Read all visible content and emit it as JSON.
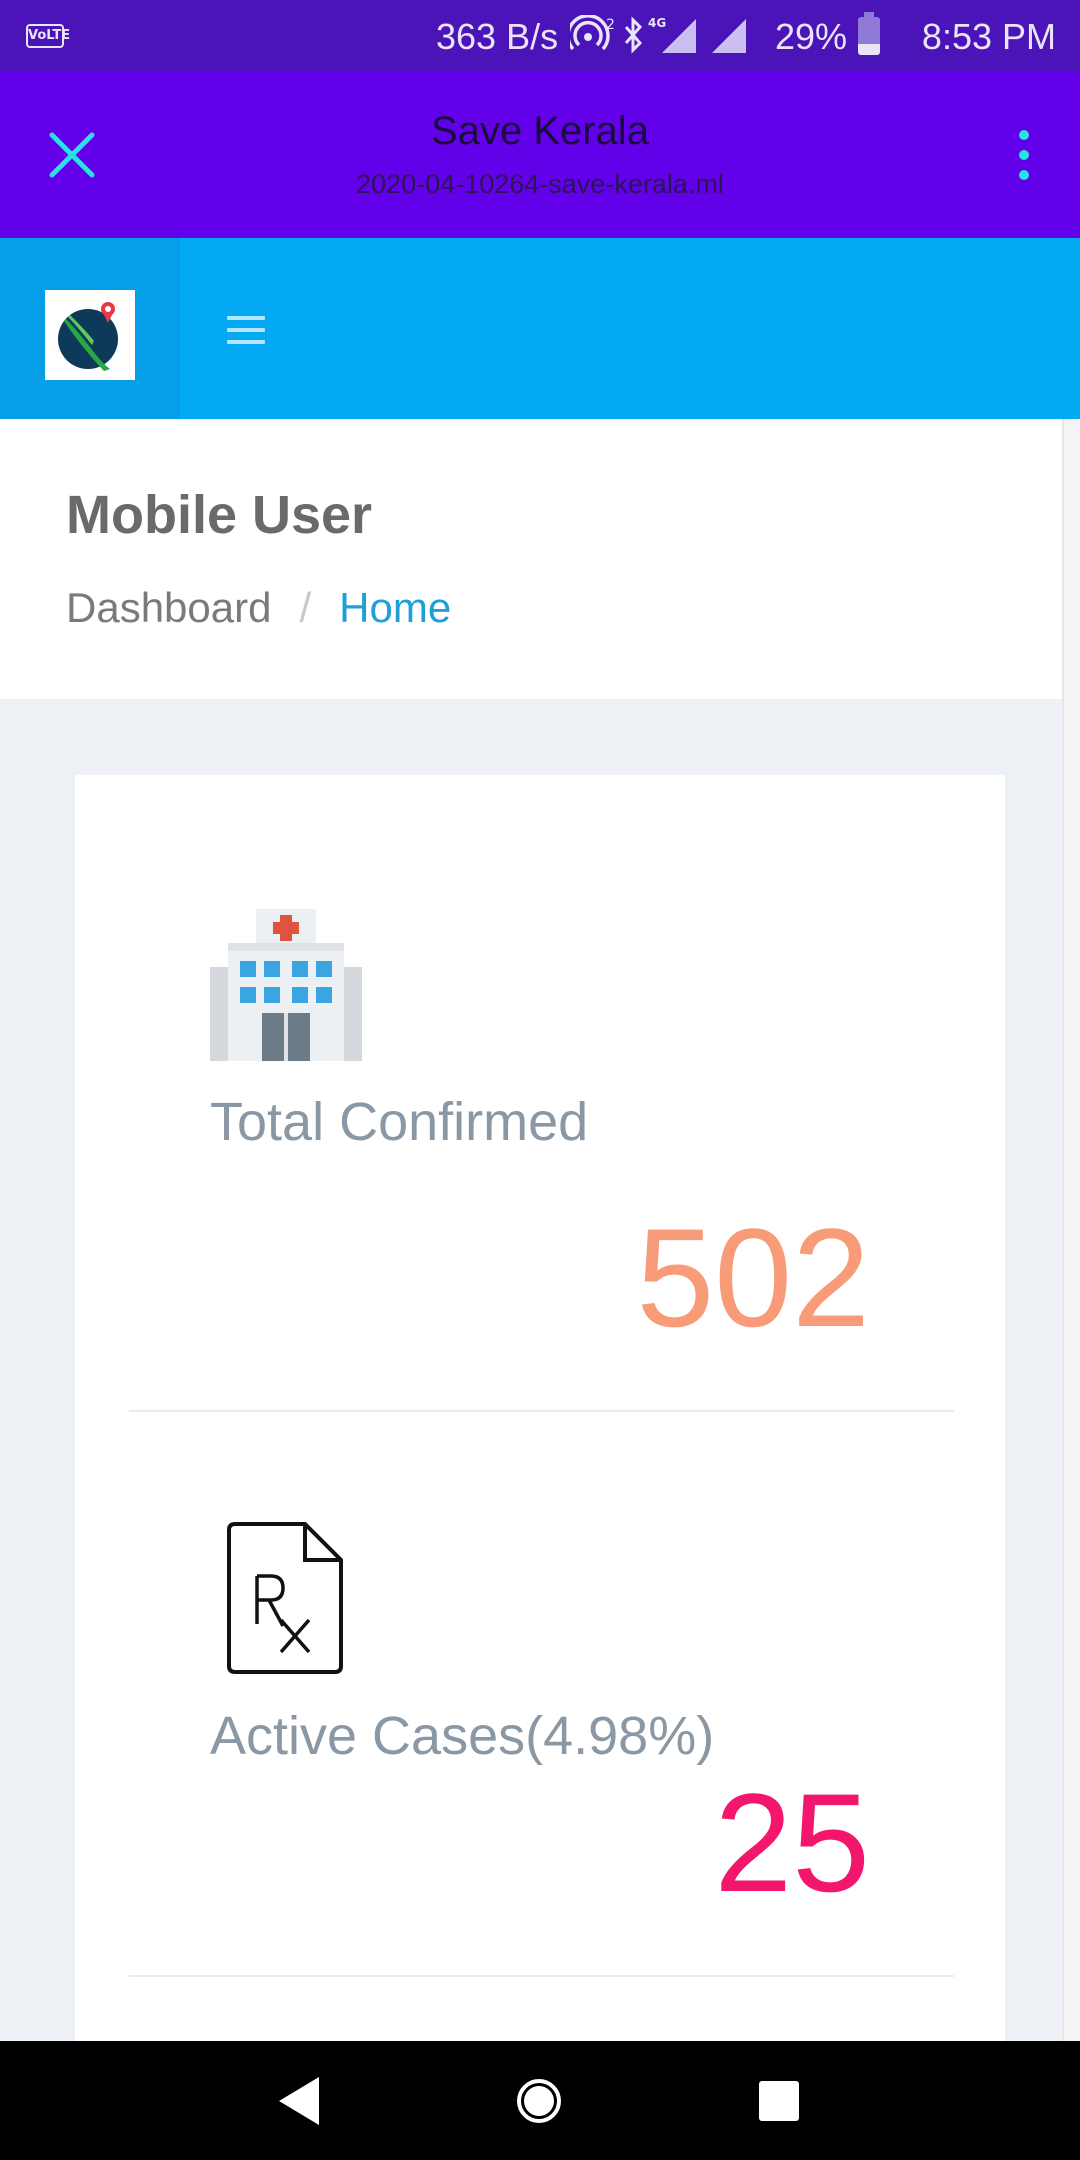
{
  "status_bar": {
    "volte": "VoLTE",
    "net_speed": "363 B/s",
    "battery": "29%",
    "time": "8:53 PM",
    "icons": [
      "hotspot-icon",
      "bluetooth-icon",
      "signal-4g-icon",
      "signal-icon"
    ]
  },
  "tab_bar": {
    "title": "Save Kerala",
    "url": "2020-04-10264-save-kerala.ml",
    "accent": "#29e1e6"
  },
  "header": {
    "logo": "kerala-map-logo",
    "menu_icon": "hamburger-icon"
  },
  "page": {
    "title": "Mobile User",
    "breadcrumb": [
      "Dashboard",
      "Home"
    ],
    "breadcrumb_separator": "/"
  },
  "stats": [
    {
      "icon": "hospital-icon",
      "label": "Total Confirmed",
      "value": "502",
      "color": "#f79b78"
    },
    {
      "icon": "prescription-icon",
      "label": "Active Cases(4.98%)",
      "value": "25",
      "color": "#f2176c"
    }
  ],
  "colors": {
    "status_bar": "#4a14b8",
    "tab_bar": "#6200ea",
    "header": "#03a9f3",
    "breadcrumb_active": "#1e9fd8"
  },
  "nav": [
    "back-icon",
    "home-icon",
    "recents-icon"
  ]
}
